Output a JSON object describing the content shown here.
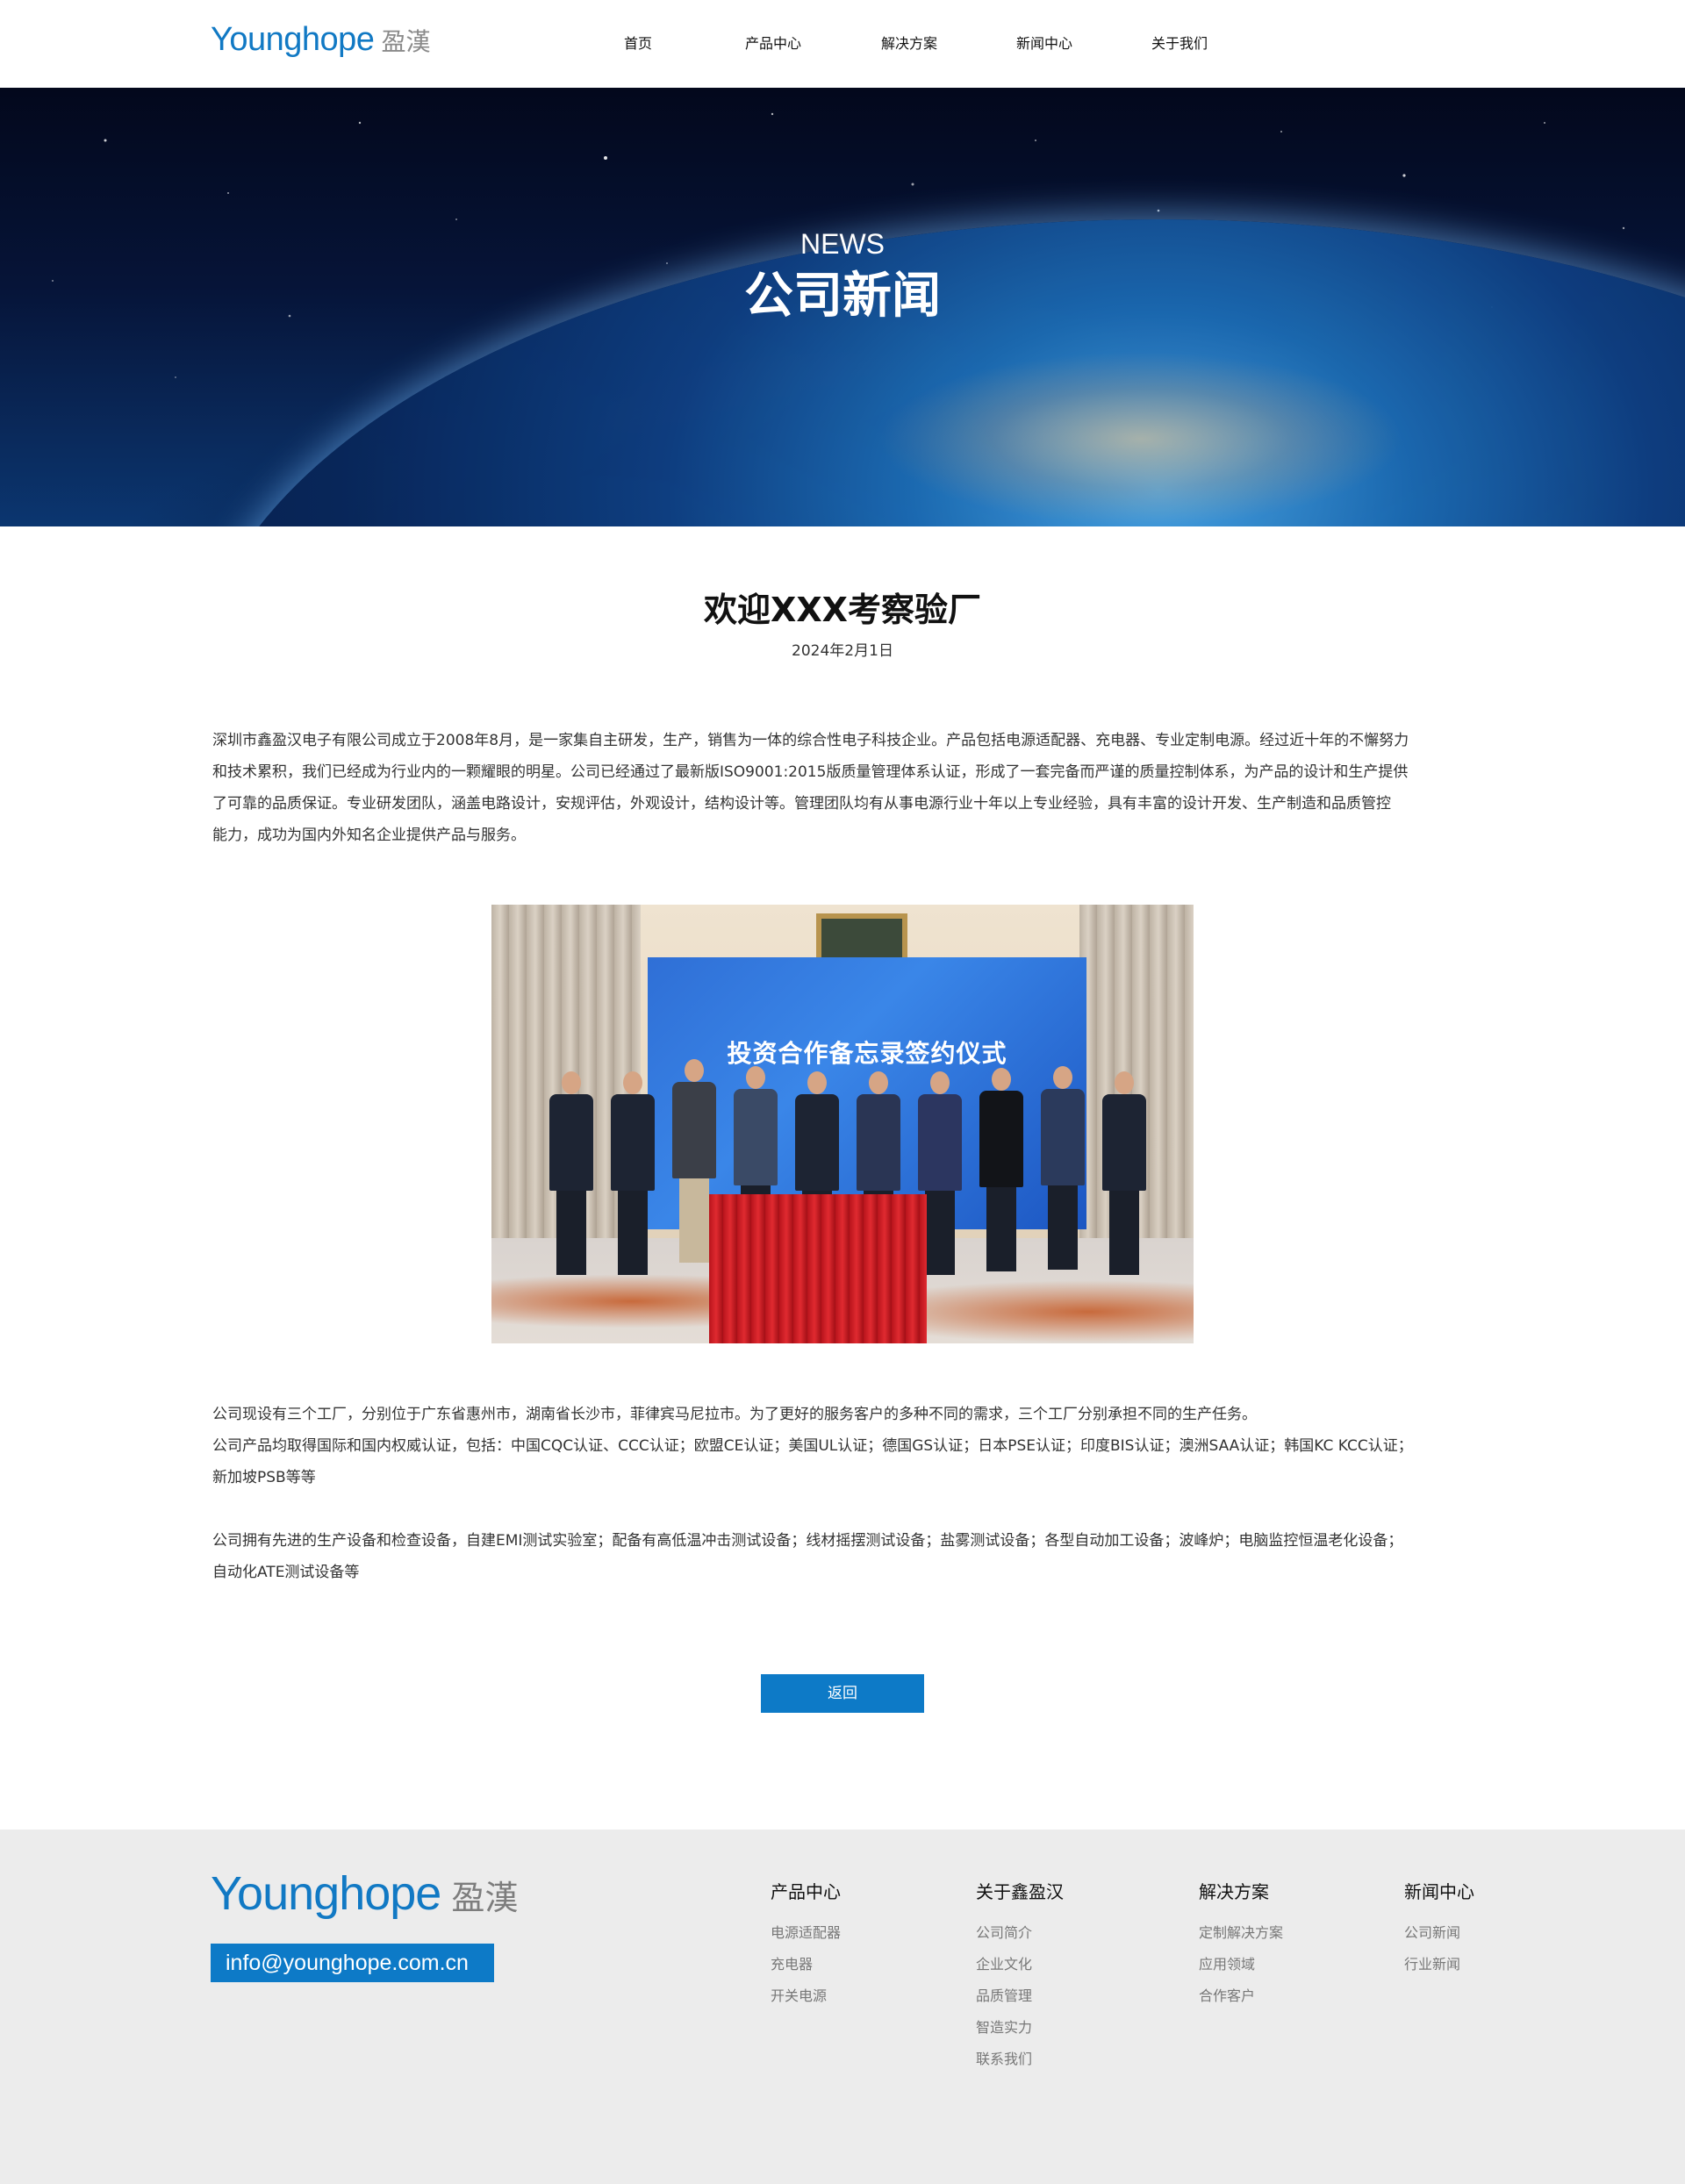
{
  "header": {
    "logo_en": "Younghope",
    "logo_cn": "盈漢",
    "nav": [
      "首页",
      "产品中心",
      "解决方案",
      "新闻中心",
      "关于我们"
    ]
  },
  "banner": {
    "subtitle": "NEWS",
    "title": "公司新闻"
  },
  "article": {
    "title": "欢迎XXX考察验厂",
    "date": "2024年2月1日",
    "para1_lines": [
      "深圳市鑫盈汉电子有限公司成立于2008年8月，是一家集自主研发，生产，销售为一体的综合性电子科技企业。产品包括电源适配器、充电器、专业定制电源。经过近十年的不懈努力",
      "和技术累积，我们已经成为行业内的一颗耀眼的明星。公司已经通过了最新版ISO9001:2015版质量管理体系认证，形成了一套完备而严谨的质量控制体系，为产品的设计和生产提供",
      "了可靠的品质保证。专业研发团队，涵盖电路设计，安规评估，外观设计，结构设计等。管理团队均有从事电源行业十年以上专业经验，具有丰富的设计开发、生产制造和品质管控",
      "能力，成功为国内外知名企业提供产品与服务。"
    ],
    "photo_banner_text": "投资合作备忘录签约仪式",
    "para2_lines": [
      "公司现设有三个工厂，分别位于广东省惠州市，湖南省长沙市，菲律宾马尼拉市。为了更好的服务客户的多种不同的需求，三个工厂分别承担不同的生产任务。",
      "公司产品均取得国际和国内权威认证，包括：中国CQC认证、CCC认证；欧盟CE认证；美国UL认证；德国GS认证；日本PSE认证；印度BIS认证；澳洲SAA认证；韩国KC KCC认证；",
      "新加坡PSB等等"
    ],
    "para3_lines": [
      "公司拥有先进的生产设备和检查设备，自建EMI测试实验室；配备有高低温冲击测试设备；线材摇摆测试设备；盐雾测试设备；各型自动加工设备；波峰炉；电脑监控恒温老化设备；",
      "自动化ATE测试设备等"
    ],
    "back_label": "返回"
  },
  "footer": {
    "logo_en": "Younghope",
    "logo_cn": "盈漢",
    "email": "info@younghope.com.cn",
    "columns": [
      {
        "title": "产品中心",
        "links": [
          "电源适配器",
          "充电器",
          "开关电源"
        ]
      },
      {
        "title": "关于鑫盈汉",
        "links": [
          "公司简介",
          "企业文化",
          "品质管理",
          "智造实力",
          "联系我们"
        ]
      },
      {
        "title": "解决方案",
        "links": [
          "定制解决方案",
          "应用领域",
          "合作客户"
        ]
      },
      {
        "title": "新闻中心",
        "links": [
          "公司新闻",
          "行业新闻"
        ]
      }
    ]
  },
  "colors": {
    "accent": "#0d7ac7",
    "footer_bg": "#ececec"
  }
}
